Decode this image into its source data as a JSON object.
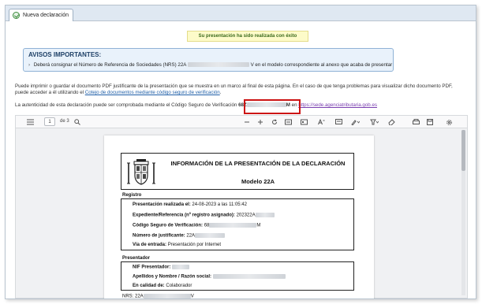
{
  "tab": {
    "label": "Nueva declaración",
    "icon": "check-circle-icon"
  },
  "toast": {
    "message": "Su presentación ha sido realizada con éxito"
  },
  "avisos": {
    "title": "AVISOS IMPORTANTES:",
    "line_prefix": "Deberá consignar el Número de Referencia de Sociedades (NRS) 22A",
    "line_suffix": "V en el modelo correspondiente al anexo que acaba de presentar"
  },
  "info": {
    "p1_line1": "Puede imprimir o guardar el documento PDF justificante de la presentación que se muestra en un marco al final de esta página. En el caso de que tenga problemas para visualizar dicho documento PDF,",
    "p1_line2_prefix": "puede acceder a él utilizando el ",
    "p1_link": "Cotejo de documentos mediante código seguro de verificación",
    "p1_line2_suffix": ".",
    "p2_prefix": "La autenticidad de esta declaración puede ser comprobada mediante el Código Seguro de Verificación ",
    "csv_start": "68Z",
    "csv_end": "M",
    "p2_mid": " en ",
    "p2_link": "https://sede.agenciatributaria.gob.es"
  },
  "viewer": {
    "page_number": "1",
    "page_of": "de 3",
    "icons": [
      "sidebar-toggle-icon",
      "search-icon",
      "zoom-out-icon",
      "zoom-in-icon",
      "rotate-icon",
      "fit-width-icon",
      "page-view-icon",
      "text-size-icon",
      "draw-icon",
      "highlight-icon",
      "eraser-icon",
      "print-icon",
      "save-icon",
      "settings-icon"
    ]
  },
  "pdf": {
    "title": "INFORMACIÓN DE LA PRESENTACIÓN DE LA DECLARACIÓN",
    "model": "Modelo 22A",
    "registro_label": "Registro",
    "registro": [
      {
        "label": "Presentación realizada el:",
        "value": "24-08-2023 a las 11:05:42"
      },
      {
        "label": "Expediente/Referencia (nº registro asignado):",
        "value": "202322A"
      },
      {
        "label": "Código Seguro de Verificación:",
        "value": "68",
        "value_end": "M"
      },
      {
        "label": "Número de justificante:",
        "value": "22A"
      },
      {
        "label": "Vía de entrada:",
        "value": "Presentación por Internet"
      }
    ],
    "presentador_label": "Presentador",
    "presentador": [
      {
        "label": "NIF Presentador:",
        "value": ""
      },
      {
        "label": "Apellidos y Nombre / Razón social:",
        "value": ""
      },
      {
        "label": "En calidad de:",
        "value": "Colaborador"
      }
    ],
    "nrs_prefix": "NRS: 22A",
    "nrs_suffix": "V"
  },
  "colors": {
    "avisos_bg": "#e9f2fb",
    "toast_bg": "#fdfbc9",
    "highlight_box": "#cc1414",
    "link": "#1f5fa8"
  }
}
